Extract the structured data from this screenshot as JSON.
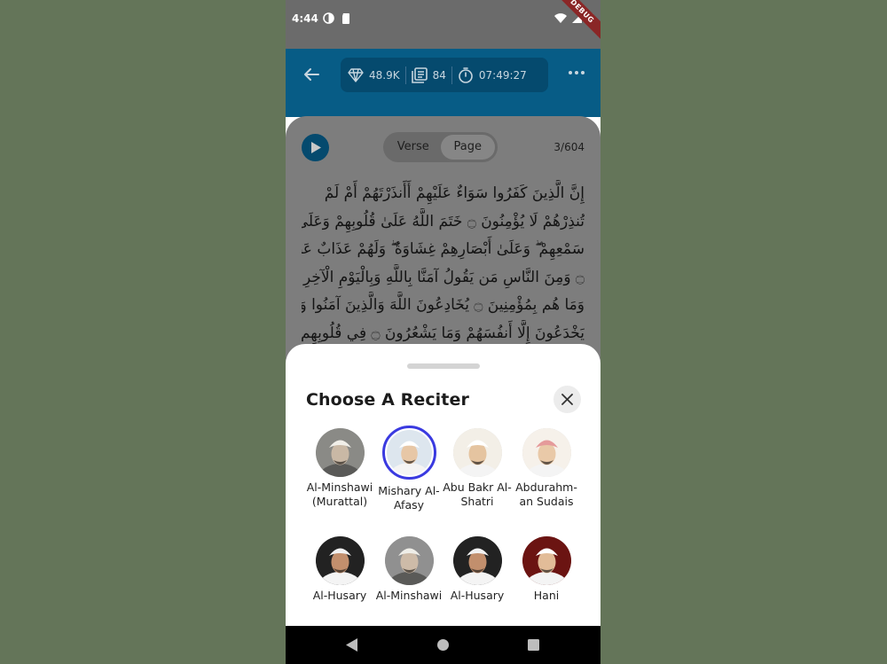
{
  "status_bar": {
    "time": "4:44",
    "debug_label": "DEBUG"
  },
  "app_bar": {
    "stats": [
      {
        "icon": "gem-icon",
        "value": "48.9K"
      },
      {
        "icon": "pages-icon",
        "value": "84"
      },
      {
        "icon": "timer-icon",
        "value": "07:49:27"
      }
    ]
  },
  "reader": {
    "segment": {
      "options": [
        "Verse",
        "Page"
      ],
      "selected": "Page"
    },
    "page_indicator": "3/604",
    "arabic_lines": [
      "إِنَّ الَّذِينَ كَفَرُوا سَوَاءٌ عَلَيْهِمْ أَأَنذَرْتَهُمْ أَمْ لَمْ",
      "تُنذِرْهُمْ لَا يُؤْمِنُونَ ۝ خَتَمَ اللَّهُ عَلَىٰ قُلُوبِهِمْ وَعَلَىٰ",
      "سَمْعِهِمْ ۖ وَعَلَىٰ أَبْصَارِهِمْ غِشَاوَةٌ ۖ وَلَهُمْ عَذَابٌ عَظِيمٌ",
      "۝ وَمِنَ النَّاسِ مَن يَقُولُ آمَنَّا بِاللَّهِ وَبِالْيَوْمِ الْآخِرِ",
      "وَمَا هُم بِمُؤْمِنِينَ ۝ يُخَادِعُونَ اللَّهَ وَالَّذِينَ آمَنُوا وَمَا",
      "يَخْدَعُونَ إِلَّا أَنفُسَهُمْ وَمَا يَشْعُرُونَ ۝ فِي قُلُوبِهِم"
    ]
  },
  "sheet": {
    "title": "Choose A Reciter",
    "reciters": [
      {
        "name": "Al-Minshawi (Murattal)",
        "selected": false,
        "skin": "#c9b8a5",
        "bg": "#8a8a86",
        "headwear": "#f1efe9",
        "style": "bw"
      },
      {
        "name": "Mishary Al-Afasy",
        "selected": true,
        "skin": "#e7c7a6",
        "bg": "#dde6ee",
        "headwear": "#ffffff",
        "style": "color"
      },
      {
        "name": "Abu Bakr Al-Shatri",
        "selected": false,
        "skin": "#e5c4a0",
        "bg": "#f3efe7",
        "headwear": "#ffffff",
        "style": "color"
      },
      {
        "name": "Abdurahm-an Sudais",
        "selected": false,
        "skin": "#e9c9a8",
        "bg": "#f6f1ea",
        "headwear": "#e59a9a",
        "style": "color"
      },
      {
        "name": "Al-Husary",
        "selected": false,
        "skin": "#c28f6d",
        "bg": "#222222",
        "headwear": "#f2f2f2",
        "style": "color"
      },
      {
        "name": "Al-Minshawi",
        "selected": false,
        "skin": "#cdbba8",
        "bg": "#909090",
        "headwear": "#efeee8",
        "style": "bw"
      },
      {
        "name": "Al-Husary",
        "selected": false,
        "skin": "#c28f6d",
        "bg": "#222222",
        "headwear": "#f2f2f2",
        "style": "color"
      },
      {
        "name": "Hani",
        "selected": false,
        "skin": "#e2bc98",
        "bg": "#6b1412",
        "headwear": "#ffffff",
        "style": "color"
      }
    ]
  },
  "colors": {
    "app_bar": "#075c86",
    "stats_pill": "#054a6e",
    "selection_ring": "#3a3ae0",
    "background": "#647559"
  }
}
